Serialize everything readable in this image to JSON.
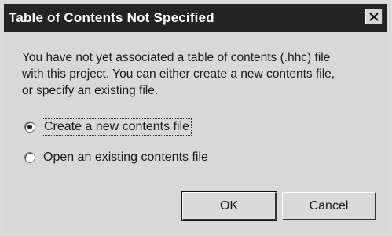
{
  "dialog": {
    "title": "Table of Contents Not Specified",
    "message_lines": [
      "You have not yet associated a table of contents (.hhc) file",
      "with this project. You can either create a new contents file,",
      "or specify an existing file."
    ],
    "options": [
      {
        "label": "Create a new contents file",
        "selected": true
      },
      {
        "label": "Open an existing contents file",
        "selected": false
      }
    ],
    "buttons": {
      "ok_label": "OK",
      "cancel_label": "Cancel"
    }
  }
}
